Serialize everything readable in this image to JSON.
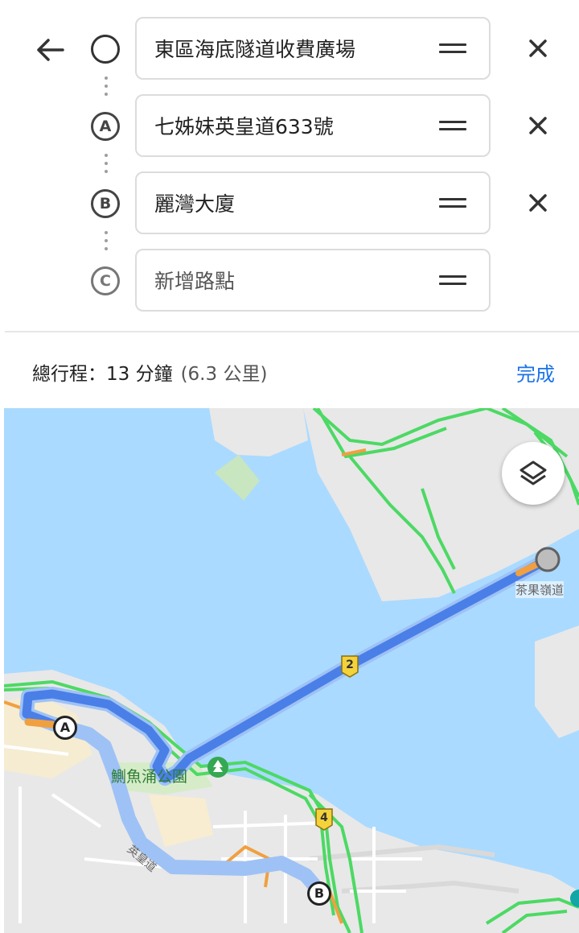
{
  "header": {
    "back_icon": "arrow-left-icon",
    "waypoints": [
      {
        "marker": "",
        "marker_icon": "circle-origin-icon",
        "value": "東區海底隧道收費廣場",
        "removable": true
      },
      {
        "marker": "A",
        "value": "七姊妹英皇道633號",
        "removable": true
      },
      {
        "marker": "B",
        "value": "麗灣大廈",
        "removable": true
      },
      {
        "marker": "C",
        "placeholder": "新增路點",
        "removable": false
      }
    ]
  },
  "summary": {
    "label": "總行程：13 分鐘",
    "distance": "(6.3 公里)",
    "done_label": "完成"
  },
  "map": {
    "layers_icon": "layers-icon",
    "labels": {
      "road_chaguo": "茶果嶺道",
      "park": "鰂魚涌公園",
      "road_kings": "英皇道",
      "route_2": "2",
      "route_4": "4",
      "pin_a": "A",
      "pin_b": "B"
    },
    "colors": {
      "water": "#aadaff",
      "land": "#e8e8e8",
      "route": "#4a7fe8",
      "traffic_fast": "#4cd964",
      "traffic_slow": "#f0a040",
      "accent": "#1a73e8"
    }
  }
}
